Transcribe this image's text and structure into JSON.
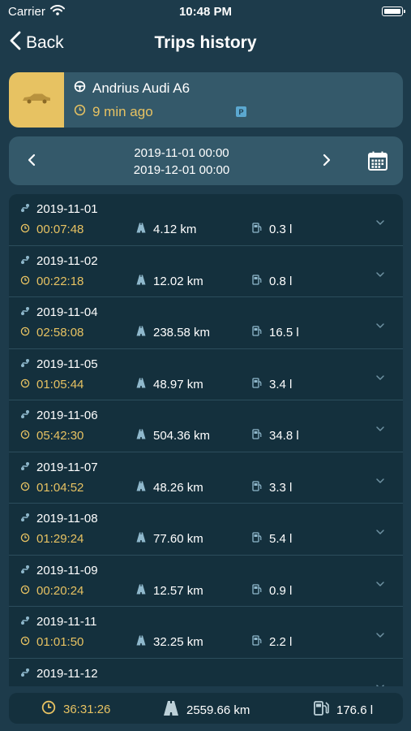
{
  "status_bar": {
    "carrier": "Carrier",
    "time": "10:48 PM"
  },
  "nav": {
    "back_label": "Back",
    "title": "Trips history"
  },
  "vehicle": {
    "name": "Andrius Audi A6",
    "last_seen": "9 min ago",
    "parking_badge": "P"
  },
  "date_range": {
    "from": "2019-11-01 00:00",
    "to": "2019-12-01 00:00"
  },
  "trips": [
    {
      "date": "2019-11-01",
      "duration": "00:07:48",
      "distance": "4.12 km",
      "fuel": "0.3 l"
    },
    {
      "date": "2019-11-02",
      "duration": "00:22:18",
      "distance": "12.02 km",
      "fuel": "0.8 l"
    },
    {
      "date": "2019-11-04",
      "duration": "02:58:08",
      "distance": "238.58 km",
      "fuel": "16.5 l"
    },
    {
      "date": "2019-11-05",
      "duration": "01:05:44",
      "distance": "48.97 km",
      "fuel": "3.4 l"
    },
    {
      "date": "2019-11-06",
      "duration": "05:42:30",
      "distance": "504.36 km",
      "fuel": "34.8 l"
    },
    {
      "date": "2019-11-07",
      "duration": "01:04:52",
      "distance": "48.26 km",
      "fuel": "3.3 l"
    },
    {
      "date": "2019-11-08",
      "duration": "01:29:24",
      "distance": "77.60 km",
      "fuel": "5.4 l"
    },
    {
      "date": "2019-11-09",
      "duration": "00:20:24",
      "distance": "12.57 km",
      "fuel": "0.9 l"
    },
    {
      "date": "2019-11-11",
      "duration": "01:01:50",
      "distance": "32.25 km",
      "fuel": "2.2 l"
    },
    {
      "date": "2019-11-12",
      "duration": "",
      "distance": "",
      "fuel": ""
    }
  ],
  "totals": {
    "duration": "36:31:26",
    "distance": "2559.66 km",
    "fuel": "176.6 l"
  },
  "icons": {
    "trip": "route-icon",
    "duration": "clock-icon",
    "distance": "road-icon",
    "fuel": "fuel-pump-icon",
    "expand": "chevron-down-icon"
  },
  "colors": {
    "background": "#1d3b4b",
    "card": "#34596a",
    "list": "#14303d",
    "accent": "#e7c262",
    "badge": "#5ba8d0"
  }
}
